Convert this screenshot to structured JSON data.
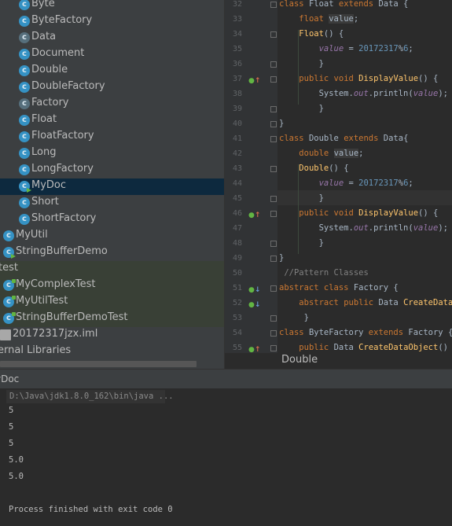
{
  "project_tree": {
    "items": [
      {
        "label": "Byte",
        "icon": "class-icon",
        "kind": "class"
      },
      {
        "label": "ByteFactory",
        "icon": "class-icon",
        "kind": "class"
      },
      {
        "label": "Data",
        "icon": "abstract-class-icon",
        "kind": "abstract"
      },
      {
        "label": "Document",
        "icon": "class-icon",
        "kind": "class"
      },
      {
        "label": "Double",
        "icon": "class-icon",
        "kind": "class"
      },
      {
        "label": "DoubleFactory",
        "icon": "class-icon",
        "kind": "class"
      },
      {
        "label": "Factory",
        "icon": "abstract-class-icon",
        "kind": "abstract"
      },
      {
        "label": "Float",
        "icon": "class-icon",
        "kind": "class"
      },
      {
        "label": "FloatFactory",
        "icon": "class-icon",
        "kind": "class"
      },
      {
        "label": "Long",
        "icon": "class-icon",
        "kind": "class"
      },
      {
        "label": "LongFactory",
        "icon": "class-icon",
        "kind": "class"
      },
      {
        "label": "MyDoc",
        "icon": "main-class-icon",
        "kind": "main",
        "selected": true
      },
      {
        "label": "Short",
        "icon": "class-icon",
        "kind": "class"
      },
      {
        "label": "ShortFactory",
        "icon": "class-icon",
        "kind": "class"
      },
      {
        "label": "MyUtil",
        "icon": "class-icon",
        "kind": "class"
      },
      {
        "label": "StringBufferDemo",
        "icon": "main-class-icon",
        "kind": "main"
      },
      {
        "label": "test",
        "icon": "",
        "kind": "folder"
      },
      {
        "label": "MyComplexTest",
        "icon": "test-class-icon",
        "kind": "test"
      },
      {
        "label": "MyUtilTest",
        "icon": "test-class-icon",
        "kind": "test"
      },
      {
        "label": "StringBufferDemoTest",
        "icon": "test-class-icon",
        "kind": "test"
      },
      {
        "label": "20172317jzx.iml",
        "icon": "iml-file-icon",
        "kind": "file"
      },
      {
        "label": "ernal Libraries",
        "icon": "",
        "kind": "folder"
      }
    ]
  },
  "editor": {
    "line_numbers": [
      "32",
      "33",
      "34",
      "35",
      "36",
      "37",
      "38",
      "39",
      "40",
      "41",
      "42",
      "43",
      "44",
      "45",
      "46",
      "47",
      "48",
      "49",
      "50",
      "51",
      "52",
      "53",
      "54",
      "55"
    ],
    "code_lines": [
      [
        [
          "kw",
          "class "
        ],
        [
          "",
          "Float "
        ],
        [
          "kw",
          "extends "
        ],
        [
          "",
          "Data {"
        ]
      ],
      [
        [
          "",
          "    "
        ],
        [
          "kw",
          "float "
        ],
        [
          "hl",
          "value"
        ],
        [
          "",
          ";"
        ]
      ],
      [
        [
          "",
          "    "
        ],
        [
          "fn",
          "Float"
        ],
        [
          "",
          "() {"
        ]
      ],
      [
        [
          "",
          "        "
        ],
        [
          "fld",
          "value"
        ],
        [
          "",
          " = "
        ],
        [
          "num",
          "20172317"
        ],
        [
          "",
          "%"
        ],
        [
          "num",
          "6"
        ],
        [
          "",
          ";"
        ]
      ],
      [
        [
          "",
          "        }"
        ]
      ],
      [
        [
          "",
          "    "
        ],
        [
          "kw",
          "public void "
        ],
        [
          "fn",
          "DisplayValue"
        ],
        [
          "",
          "() {"
        ]
      ],
      [
        [
          "",
          "        System."
        ],
        [
          "fld",
          "out"
        ],
        [
          "",
          ".println("
        ],
        [
          "fld",
          "value"
        ],
        [
          "",
          ");"
        ]
      ],
      [
        [
          "",
          "        }"
        ]
      ],
      [
        [
          "",
          "}"
        ]
      ],
      [
        [
          "kw",
          "class "
        ],
        [
          "",
          "Double "
        ],
        [
          "kw",
          "extends "
        ],
        [
          "",
          "Data{"
        ]
      ],
      [
        [
          "",
          "    "
        ],
        [
          "kw",
          "double "
        ],
        [
          "hl",
          "value"
        ],
        [
          "",
          ";"
        ]
      ],
      [
        [
          "",
          "    "
        ],
        [
          "fn",
          "Double"
        ],
        [
          "",
          "() {"
        ]
      ],
      [
        [
          "",
          "        "
        ],
        [
          "fld",
          "value"
        ],
        [
          "",
          " = "
        ],
        [
          "num",
          "20172317"
        ],
        [
          "",
          "%"
        ],
        [
          "num",
          "6"
        ],
        [
          "",
          ";"
        ]
      ],
      [
        [
          "",
          "        }"
        ]
      ],
      [
        [
          "",
          "    "
        ],
        [
          "kw",
          "public void "
        ],
        [
          "fn",
          "DisplayValue"
        ],
        [
          "",
          "() {"
        ]
      ],
      [
        [
          "",
          "        System."
        ],
        [
          "fld",
          "out"
        ],
        [
          "",
          ".println("
        ],
        [
          "fld",
          "value"
        ],
        [
          "",
          ");"
        ]
      ],
      [
        [
          "",
          "        }"
        ]
      ],
      [
        [
          "",
          "}"
        ]
      ],
      [
        [
          "cm",
          " //Pattern Classes"
        ]
      ],
      [
        [
          "kw",
          "abstract class "
        ],
        [
          "",
          "Factory {"
        ]
      ],
      [
        [
          "",
          "    "
        ],
        [
          "kw",
          "abstract public "
        ],
        [
          "",
          "Data "
        ],
        [
          "fn",
          "CreateDataObj"
        ]
      ],
      [
        [
          "",
          "     }"
        ]
      ],
      [
        [
          "kw",
          "class "
        ],
        [
          "",
          "ByteFactory "
        ],
        [
          "kw",
          "extends "
        ],
        [
          "",
          "Factory {"
        ]
      ],
      [
        [
          "",
          "    "
        ],
        [
          "kw",
          "public "
        ],
        [
          "",
          "Data "
        ],
        [
          "fn",
          "CreateDataObject"
        ],
        [
          "",
          "() {"
        ]
      ]
    ]
  },
  "breadcrumb": {
    "text": "Double"
  },
  "run_panel": {
    "tab_label": "yDoc",
    "command": "D:\\Java\\jdk1.8.0_162\\bin\\java ...",
    "output": [
      "5",
      "5",
      "5",
      "5.0",
      "5.0",
      "",
      "Process finished with exit code 0"
    ]
  },
  "colors": {
    "tree_bg": "#3c3f41",
    "editor_bg": "#2b2b2b",
    "keyword": "#cc7832",
    "number": "#6897bb",
    "method": "#ffc66d",
    "field": "#9876aa",
    "selection": "#0d293e"
  }
}
